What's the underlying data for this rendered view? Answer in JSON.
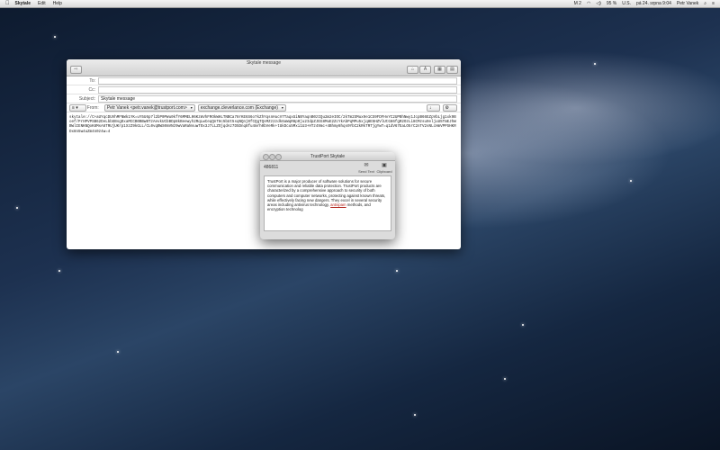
{
  "menubar": {
    "apple_icon": "apple-logo",
    "app_name": "Skytale",
    "items": [
      "Edit",
      "Help"
    ],
    "status": {
      "input_source": "M 2",
      "battery": "95 %",
      "keyboard": "U.S.",
      "clock": "pá 24. srpna 9:04",
      "user": "Petr Vanek"
    }
  },
  "mail": {
    "window_title": "Skytale message",
    "to_label": "To:",
    "to_value": "",
    "cc_label": "Cc:",
    "cc_value": "",
    "subject_label": "Subject:",
    "subject_value": "Skytale message",
    "from_label": "From:",
    "from_value": "Petr Vanek <petr.vanek@trustport.com>",
    "account_value": "exchange.cleverlance.com (Exchange)",
    "format_value": "≡ ▾",
    "body": "skytale://C+aUYqcDUVhMFNWk1YK=uY5U6p7l2bP0PWu0kfY6MMEL06KzmVhFROkWHLTNBCa78rKE6S6o7kZhYqsnHucV7TaqxUiNBYaqnB0zIQu2m2eIOC/2kTm2SMux9e1CS9FDFHvYC2UPBhNwy1JcpB66EZpVbLjg1xk9Boef/PrHPVPSB62DeLbbGBsgDxaMCCB0BBwBTzAevkUCbBDp8kBeewyh2RqLwCeqQnT8c5bUt5sqNQnj0fCQgTQsMZz2zdk6aWqR8p0ju2IdpZJEG8MuE2ZcYkAbPqMPu5xjq8E5HZVlUtG86fgR2OzLi8CMzsu9eljuU5TmEJhWBWlIENKNQoK8MsA6TRUjUKrp1XzZ9kGLL/CL0vqBWS0mVNz9wVaRaNsuwTOx3J7LLZOjqdAz7D5Dnq8fu4mrh0bVeRk+tUkDcu5Mxi1U3+HTz49mc+4Bhmy8hqs0YbC2kRkTRTjgYwT=q1dV67EaLO5rC2nTV2sNLcHmVPPSHKRDx8n5w4uZm4n0z4w=4"
  },
  "skytale": {
    "title": "TrustPort Skytale",
    "id_label": "486811",
    "tools": [
      {
        "icon": "envelope-icon",
        "label": "Send Text"
      },
      {
        "icon": "inbox-icon",
        "label": "Clipboard"
      }
    ],
    "text_before": "TrustPort is a major producer of software solutions for secure communication and reliable data protection. TrustPort products are characterized by a comprehensive approach to security of both computers and computer networks, protecting against known threats, while effectively facing new dangers. They excel in several security areas including antivirus technology, ",
    "text_highlight": "antispam",
    "text_after": " methods, and encryption technolog"
  }
}
